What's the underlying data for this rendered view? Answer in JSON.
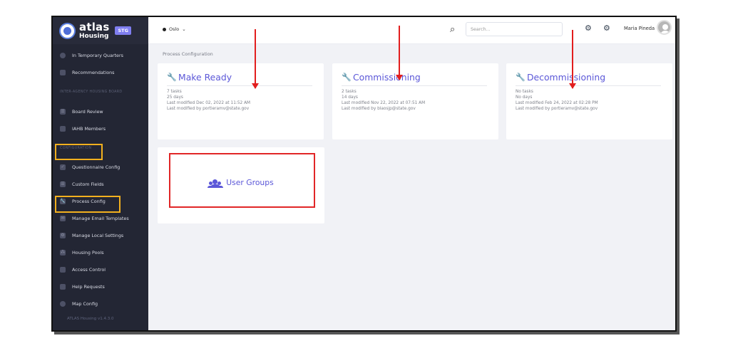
{
  "app": {
    "brand_name": "atlas",
    "brand_subtitle": "Housing",
    "environment_badge": "STG",
    "version": "ATLAS Housing v1.4.3.0"
  },
  "sidebar": {
    "top_items": [
      {
        "label": "In Temporary Quarters",
        "icon": "location-icon"
      },
      {
        "label": "Recommendations",
        "icon": "document-icon"
      }
    ],
    "section_interagency": "INTER-AGENCY HOUSING BOARD",
    "interagency_items": [
      {
        "label": "Board Review",
        "icon": "list-icon"
      },
      {
        "label": "IAHB Members",
        "icon": "users-icon"
      }
    ],
    "section_configuration": "CONFIGURATION",
    "configuration_items": [
      {
        "label": "Questionnaire Config",
        "icon": "checkbox-icon"
      },
      {
        "label": "Custom Fields",
        "icon": "list-icon"
      },
      {
        "label": "Process Config",
        "icon": "wrench-icon"
      },
      {
        "label": "Manage Email Templates",
        "icon": "email-icon"
      },
      {
        "label": "Manage Local Settings",
        "icon": "gear-icon"
      },
      {
        "label": "Housing Pools",
        "icon": "network-icon"
      },
      {
        "label": "Access Control",
        "icon": "user-lock-icon"
      },
      {
        "label": "Help Requests",
        "icon": "user-question-icon"
      },
      {
        "label": "Map Config",
        "icon": "map-pin-icon"
      }
    ]
  },
  "topbar": {
    "site": "Oslo",
    "search_placeholder": "Search...",
    "user_name": "Maria Pineda"
  },
  "main": {
    "breadcrumb": "Process Configuration",
    "process_cards": [
      {
        "title": "Make Ready",
        "details": [
          "7 tasks",
          "25 days",
          "Last modified Dec 02, 2022 at 11:52 AM",
          "Last modified by portieramv@state.gov"
        ]
      },
      {
        "title": "Commissioning",
        "details": [
          "2 tasks",
          "14 days",
          "Last modified Nov 22, 2022 at 07:51 AM",
          "Last modified by blaosjp@state.gov"
        ]
      },
      {
        "title": "Decommissioning",
        "details": [
          "No tasks",
          "No days",
          "Last modified Feb 24, 2022 at 02:28 PM",
          "Last modified by portieramv@state.gov"
        ]
      }
    ],
    "user_groups_label": "User Groups"
  },
  "colors": {
    "sidebar": "#232634",
    "accent": "#5b57d8",
    "annotation_red": "#e21e1e",
    "annotation_yellow": "#f2b01e"
  }
}
